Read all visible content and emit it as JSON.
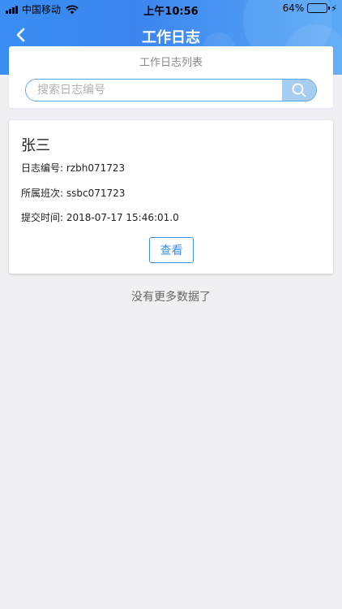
{
  "status_bar": {
    "carrier": "中国移动",
    "time": "上午10:56",
    "battery_percent": "64%",
    "battery_level": 0.64,
    "icons": [
      "signal-icon",
      "wifi-icon",
      "battery-icon",
      "charging-bolt-icon"
    ]
  },
  "nav": {
    "title": "工作日志",
    "back_icon": "chevron-left-icon"
  },
  "list": {
    "title": "工作日志列表",
    "search_placeholder": "搜索日志编号",
    "search_value": "",
    "search_icon": "search-icon"
  },
  "logs": [
    {
      "name": "张三",
      "log_no_label": "日志编号: ",
      "log_no": "rzbh071723",
      "shift_label": "所属班次: ",
      "shift": "ssbc071723",
      "submit_label": "提交时间: ",
      "submit_time": "2018-07-17 15:46:01.0",
      "view_label": "查看"
    }
  ],
  "footer": {
    "no_more": "没有更多数据了"
  },
  "colors": {
    "header": "#3a8ef2",
    "accent": "#3b8fe8",
    "background": "#efeff4",
    "search_button": "#a7cdf1"
  }
}
